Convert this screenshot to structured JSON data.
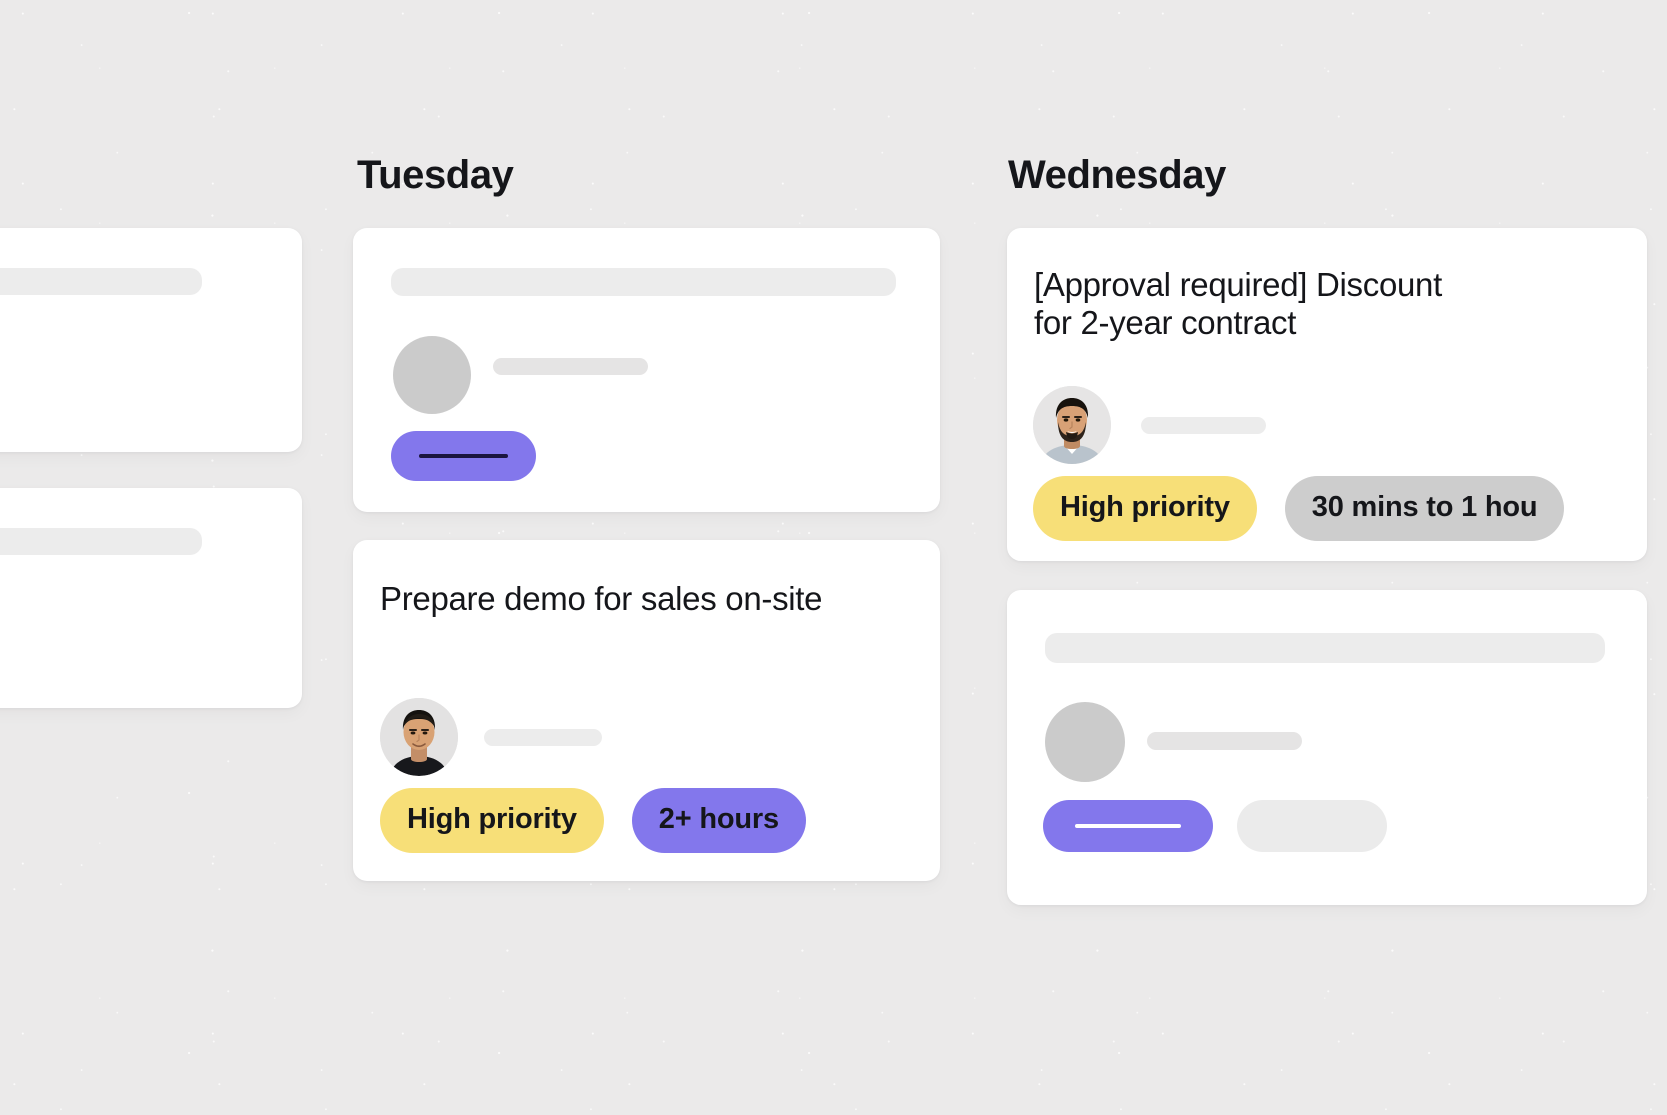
{
  "board": {
    "background_color": "#ebeaea",
    "columns": [
      {
        "id": "tuesday",
        "label": "Tuesday"
      },
      {
        "id": "wednesday",
        "label": "Wednesday"
      }
    ]
  },
  "colors": {
    "card_background": "#ffffff",
    "text_primary": "#15161a",
    "accent_purple": "#8377ec",
    "badge_yellow": "#f7df78",
    "badge_grey": "#cdcdcd",
    "skeleton_grey": "#ececec",
    "skeleton_avatar_grey": "#cbcbcb"
  },
  "cards": {
    "tuesday_demo": {
      "title": "Prepare demo for sales on-site",
      "avatar": "avatar-asian-man-black-shirt",
      "badges": [
        {
          "label": "High priority",
          "style": "yellow"
        },
        {
          "label": "2+ hours",
          "style": "purple"
        }
      ]
    },
    "wednesday_approval": {
      "title_line_1": "[Approval required] Discount",
      "title_line_2": "for 2-year contract",
      "avatar": "avatar-bearded-man-grey-shirt",
      "badges": [
        {
          "label": "High priority",
          "style": "yellow"
        },
        {
          "label": "30 mins to 1 hou",
          "style": "grey"
        }
      ]
    }
  },
  "skeleton_cards": {
    "left_top": {
      "kind": "placeholder-card",
      "clipped": "left"
    },
    "left_bottom": {
      "kind": "placeholder-card",
      "clipped": "left"
    },
    "tuesday_top": {
      "kind": "placeholder-card"
    },
    "wednesday_bottom": {
      "kind": "placeholder-card"
    }
  }
}
